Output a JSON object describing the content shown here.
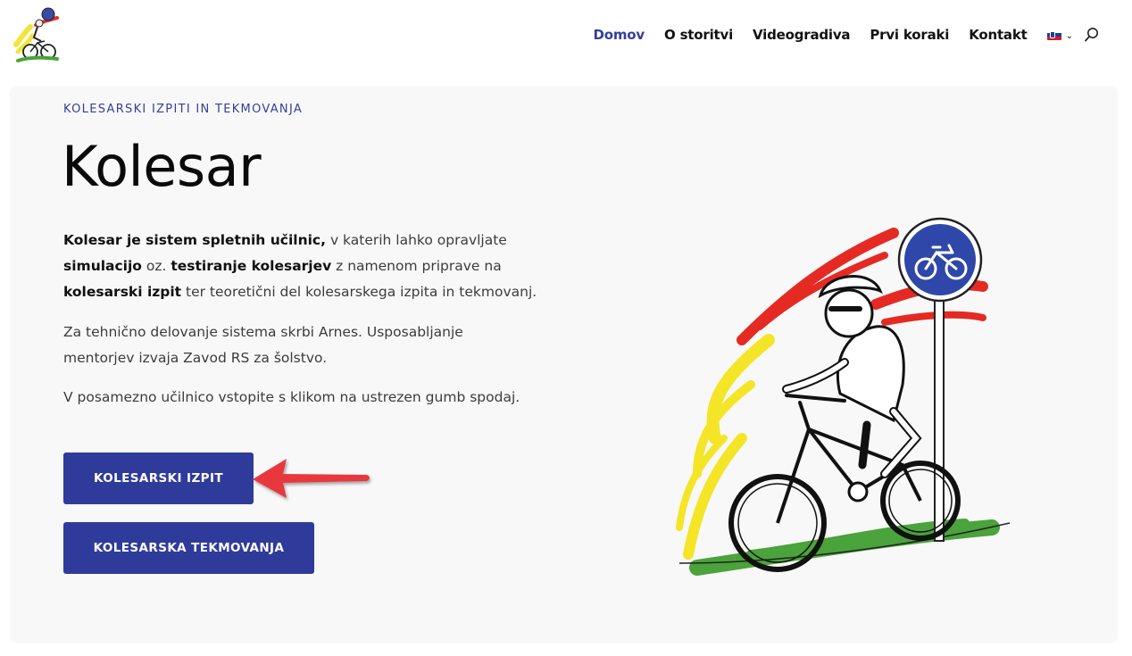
{
  "nav": {
    "items": [
      {
        "label": "Domov",
        "active": true
      },
      {
        "label": "O storitvi",
        "active": false
      },
      {
        "label": "Videogradiva",
        "active": false
      },
      {
        "label": "Prvi koraki",
        "active": false
      },
      {
        "label": "Kontakt",
        "active": false
      }
    ],
    "language_icon": "slovenian-flag-icon",
    "search_icon": "search-icon"
  },
  "hero": {
    "eyebrow": "KOLESARSKI IZPITI IN TEKMOVANJA",
    "title": "Kolesar",
    "p1": {
      "b1": "Kolesar je sistem spletnih učilnic,",
      "t1": " v katerih lahko opravljate ",
      "b2": "simulacijo",
      "t2": " oz. ",
      "b3": "testiranje kolesarjev",
      "t3": " z namenom priprave na ",
      "b4": "kolesarski izpit",
      "t4": " ter teoretični del kolesarskega izpita in tekmovanj."
    },
    "p2": "Za tehnično delovanje sistema skrbi Arnes. Usposabljanje mentorjev izvaja Zavod RS za šolstvo.",
    "p3": "V posamezno učilnico vstopite s klikom na ustrezen gumb spodaj.",
    "buttons": {
      "izpit": "KOLESARSKI IZPIT",
      "tekmovanja": "KOLESARSKA TEKMOVANJA"
    }
  },
  "colors": {
    "accent": "#2f3b9a",
    "arrow": "#e8383d",
    "hero_bg": "#f8f8f8"
  }
}
